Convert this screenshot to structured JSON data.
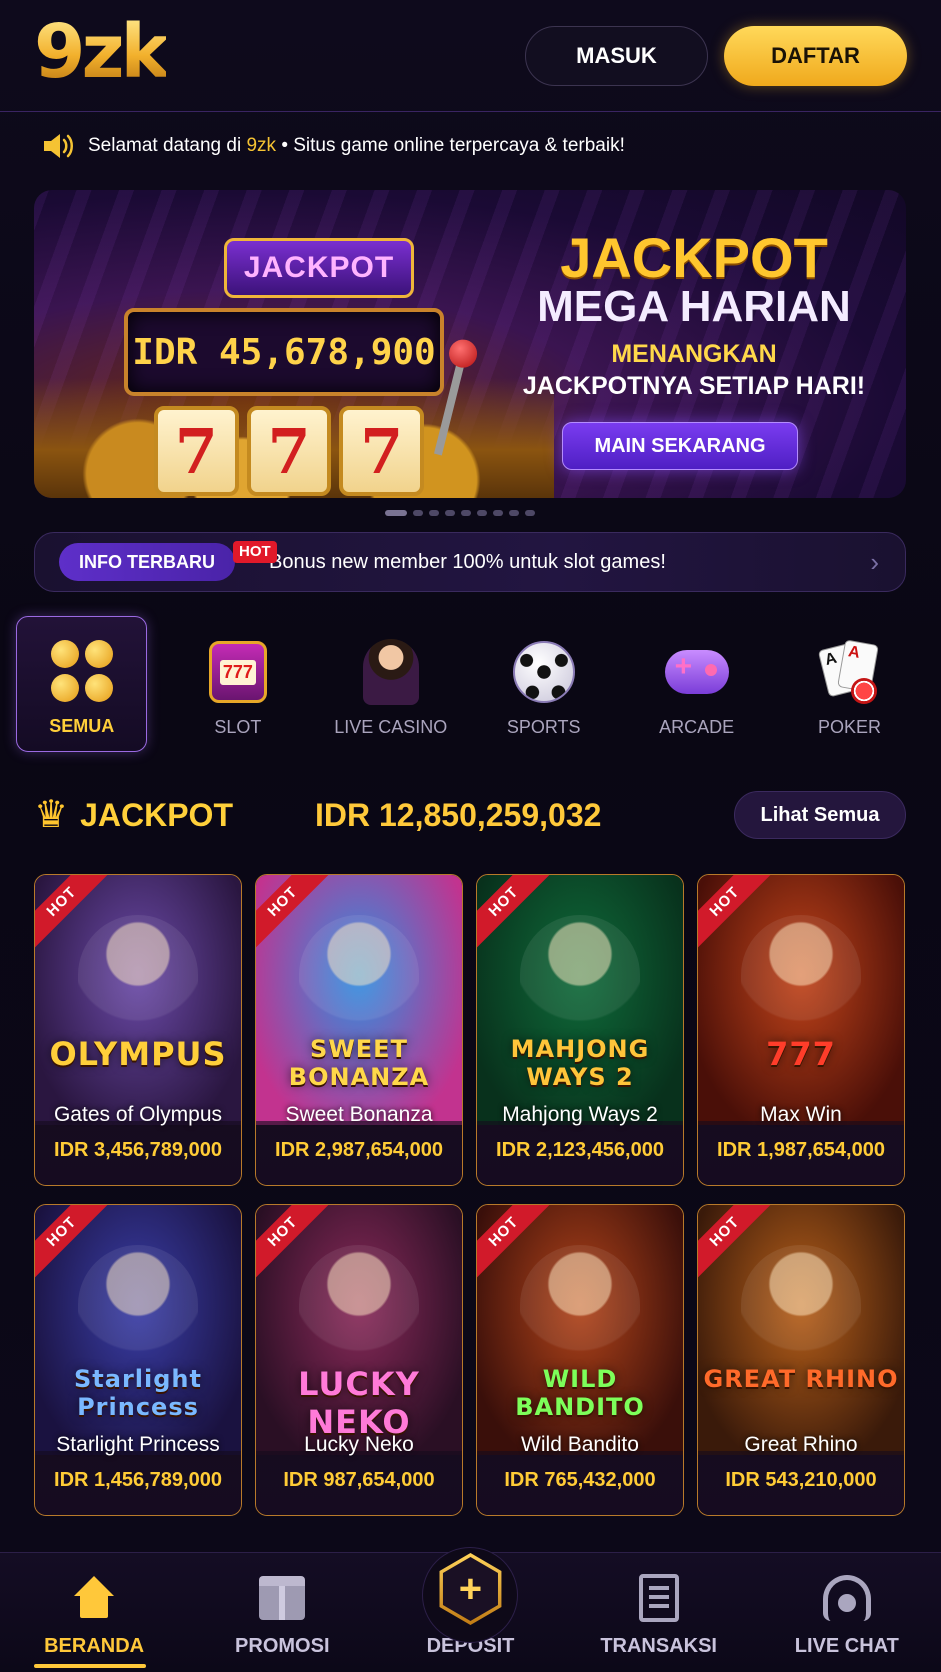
{
  "header": {
    "logo": "9zk",
    "login_label": "MASUK",
    "register_label": "DAFTAR"
  },
  "marquee": {
    "icon": "speaker-icon",
    "prefix": "Selamat datang di",
    "brand": "9zk",
    "suffix": "• Situs game online terpercaya & terbaik!"
  },
  "banner": {
    "slot_top": "JACKPOT",
    "slot_display": "IDR 45,678,900",
    "reels": [
      "7",
      "7",
      "7"
    ],
    "title1": "JACKPOT",
    "title2": "MEGA HARIAN",
    "sub1": "MENANGKAN",
    "sub2": "JACKPOTNYA SETIAP HARI!",
    "cta": "MAIN SEKARANG",
    "slides_total": 9,
    "active_slide": 1
  },
  "info": {
    "pill": "INFO TERBARU",
    "hot": "HOT",
    "text": "Bonus new member 100% untuk slot games!",
    "chevron": "›"
  },
  "categories": [
    {
      "label": "SEMUA",
      "icon": "grid-icon",
      "active": true
    },
    {
      "label": "SLOT",
      "icon": "slot-machine-icon"
    },
    {
      "label": "LIVE CASINO",
      "icon": "dealer-icon"
    },
    {
      "label": "SPORTS",
      "icon": "soccer-ball-icon"
    },
    {
      "label": "ARCADE",
      "icon": "gamepad-icon"
    },
    {
      "label": "POKER",
      "icon": "cards-icon"
    }
  ],
  "jackpot": {
    "crown": "♛",
    "title": "JACKPOT",
    "total": "IDR 12,850,259,032",
    "see_all": "Lihat Semua"
  },
  "games": [
    {
      "title": "Gates of Olympus",
      "logo": "OLYMPUS",
      "jackpot": "IDR 3,456,789,000",
      "hot": "HOT",
      "bg1": "#6b4aa8",
      "bg2": "#2a1640",
      "logo_color": "#ffcf3a"
    },
    {
      "title": "Sweet Bonanza",
      "logo": "SWEET BONANZA",
      "jackpot": "IDR 2,987,654,000",
      "hot": "HOT",
      "bg1": "#2f8fe0",
      "bg2": "#c2338f",
      "logo_color": "#ffd84a"
    },
    {
      "title": "Mahjong Ways 2",
      "logo": "MAHJONG WAYS 2",
      "jackpot": "IDR 2,123,456,000",
      "hot": "HOT",
      "bg1": "#0f6b3a",
      "bg2": "#08311c",
      "logo_color": "#ffc53a"
    },
    {
      "title": "Max Win",
      "logo": "777",
      "jackpot": "IDR 1,987,654,000",
      "hot": "HOT",
      "bg1": "#c2441a",
      "bg2": "#4a0f08",
      "logo_color": "#ff3d2a"
    },
    {
      "title": "Starlight Princess",
      "logo": "Starlight Princess",
      "jackpot": "IDR 1,456,789,000",
      "hot": "HOT",
      "bg1": "#3a3ea8",
      "bg2": "#1a1240",
      "logo_color": "#7ab8ff"
    },
    {
      "title": "Lucky Neko",
      "logo": "LUCKY NEKO",
      "jackpot": "IDR 987,654,000",
      "hot": "HOT",
      "bg1": "#8a2a5a",
      "bg2": "#2a0f24",
      "logo_color": "#ff7ad8"
    },
    {
      "title": "Wild Bandito",
      "logo": "WILD BANDITO",
      "jackpot": "IDR 765,432,000",
      "hot": "HOT",
      "bg1": "#b2441a",
      "bg2": "#3a0f0a",
      "logo_color": "#7dff5a"
    },
    {
      "title": "Great Rhino",
      "logo": "GREAT RHINO",
      "jackpot": "IDR 543,210,000",
      "hot": "HOT",
      "bg1": "#b8601a",
      "bg2": "#3a1a0a",
      "logo_color": "#ff6a2a"
    }
  ],
  "nav": [
    {
      "label": "BERANDA",
      "icon": "home-icon",
      "active": true
    },
    {
      "label": "PROMOSI",
      "icon": "gift-icon"
    },
    {
      "label": "DEPOSIT",
      "icon": "plus-hexagon-icon"
    },
    {
      "label": "TRANSAKSI",
      "icon": "document-icon"
    },
    {
      "label": "LIVE CHAT",
      "icon": "headset-icon"
    }
  ]
}
